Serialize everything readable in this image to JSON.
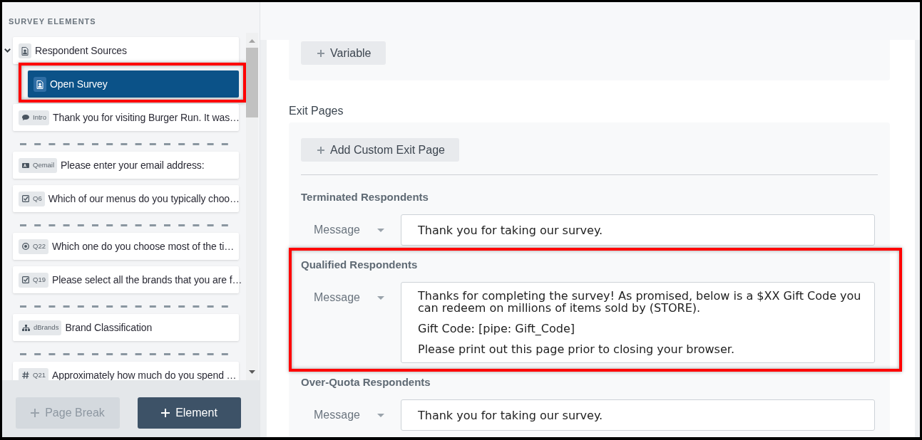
{
  "sidebar": {
    "title": "SURVEY ELEMENTS",
    "items": [
      {
        "kind": "source",
        "label": "Respondent Sources",
        "selected": false,
        "highlighted": false,
        "expanded": true,
        "children": [
          {
            "kind": "source",
            "label": "Open Survey",
            "selected": true,
            "highlighted": true
          }
        ]
      },
      {
        "kind": "text",
        "tag": "Intro",
        "label": "Thank you for visiting Burger Run. It was…",
        "selected": false,
        "highlighted": false
      },
      {
        "kind": "page_break"
      },
      {
        "kind": "email",
        "tag": "Qemail",
        "label": "Please enter your email address:",
        "selected": false,
        "highlighted": false
      },
      {
        "kind": "checkbox",
        "tag": "Q6",
        "label": "Which of our menus do you typically choo…",
        "selected": false,
        "highlighted": false
      },
      {
        "kind": "page_break"
      },
      {
        "kind": "radio",
        "tag": "Q22",
        "label": "Which one do you choose most of the ti…",
        "selected": false,
        "highlighted": false
      },
      {
        "kind": "checkbox",
        "tag": "Q19",
        "label": "Please select all the brands that you are f…",
        "selected": false,
        "highlighted": false
      },
      {
        "kind": "page_break"
      },
      {
        "kind": "hierarchy",
        "tag": "dBrands",
        "label": "Brand Classification",
        "selected": false,
        "highlighted": false
      },
      {
        "kind": "page_break"
      },
      {
        "kind": "number",
        "tag": "Q21",
        "label": "Approximately how much do you spend …",
        "selected": false,
        "highlighted": false
      }
    ],
    "buttons": [
      {
        "label": "Page Break",
        "disabled": true
      },
      {
        "label": "Element",
        "disabled": false
      }
    ]
  },
  "variables": {
    "add_button": "Variable"
  },
  "exit_pages": {
    "heading": "Exit Pages",
    "add_button": "Add Custom Exit Page",
    "sections": [
      {
        "title": "Terminated Respondents",
        "highlighted": false,
        "field_label": "Message",
        "paragraphs": [
          "Thank you for taking our survey."
        ]
      },
      {
        "title": "Qualified Respondents",
        "highlighted": true,
        "field_label": "Message",
        "paragraphs": [
          "Thanks for completing the survey! As promised, below is a $XX Gift Code you can redeem on millions of items sold by (STORE).",
          "Gift Code: [pipe: Gift_Code]",
          "Please print out this page prior to closing your browser."
        ]
      },
      {
        "title": "Over-Quota Respondents",
        "highlighted": false,
        "field_label": "Message",
        "paragraphs": [
          "Thank you for taking our survey."
        ]
      }
    ]
  }
}
